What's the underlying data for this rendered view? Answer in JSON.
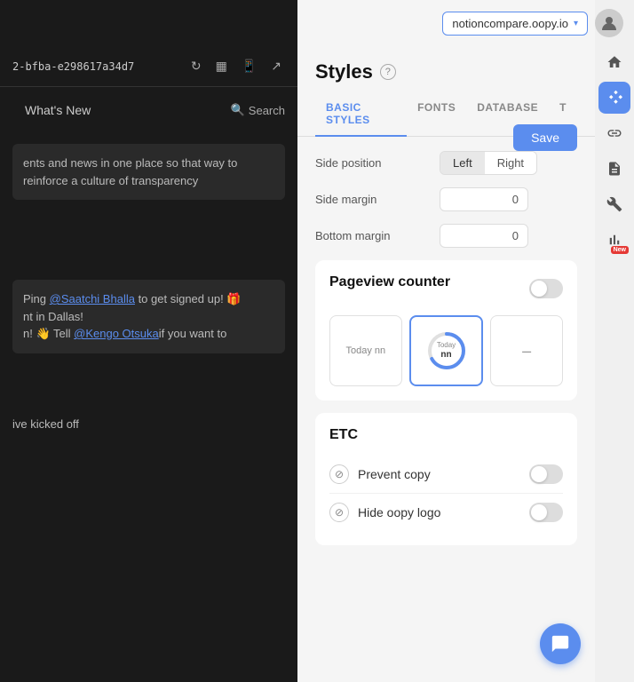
{
  "topbar": {
    "domain": "notioncompare.oopy.io",
    "chevron": "▾"
  },
  "left_panel": {
    "id": "2-bfba-e298617a34d7",
    "nav_label": "What's New",
    "search_label": "Search",
    "content1": "ents and news in one place so that way to reinforce a culture of transparency",
    "content2_mention1": "@Saatchi Bhalla",
    "content2_pre": "Ping ",
    "content2_post": " to get signed up! 🎁",
    "content3": "nt in Dallas!",
    "content4": "n! 👋 Tell ",
    "content4_mention": "@Kengo Otsuka",
    "content4_post": "if you want to",
    "content5": "ive kicked off"
  },
  "styles_panel": {
    "title": "Styles",
    "help": "?",
    "save_label": "Save",
    "tabs": [
      {
        "label": "BASIC STYLES",
        "active": true
      },
      {
        "label": "FONTS",
        "active": false
      },
      {
        "label": "DATABASE",
        "active": false
      },
      {
        "label": "T",
        "active": false
      }
    ],
    "side_position": {
      "label": "Side position",
      "options": [
        "Left",
        "Right"
      ],
      "selected": "Left"
    },
    "side_margin": {
      "label": "Side margin",
      "value": "0"
    },
    "bottom_margin": {
      "label": "Bottom margin",
      "value": "0"
    },
    "pageview_counter": {
      "title": "Pageview counter",
      "enabled": false,
      "cards": [
        {
          "type": "text",
          "label": "Today nn"
        },
        {
          "type": "ring",
          "label": "Today",
          "sublabel": "nn",
          "selected": true
        },
        {
          "type": "dash",
          "label": "–"
        }
      ]
    },
    "etc": {
      "title": "ETC",
      "items": [
        {
          "icon": "🚫",
          "label": "Prevent copy",
          "enabled": false
        },
        {
          "icon": "🚫",
          "label": "Hide oopy logo",
          "enabled": false
        }
      ]
    }
  },
  "right_sidebar": {
    "icons": [
      {
        "name": "home",
        "symbol": "⌂",
        "active": false
      },
      {
        "name": "magic",
        "symbol": "✦",
        "active": true
      },
      {
        "name": "link",
        "symbol": "🔗",
        "active": false
      },
      {
        "name": "file",
        "symbol": "📄",
        "active": false
      },
      {
        "name": "wrench",
        "symbol": "🔧",
        "active": false
      },
      {
        "name": "chart",
        "symbol": "📊",
        "active": false,
        "badge": "New"
      }
    ]
  },
  "fab": {
    "icon": "💬"
  }
}
